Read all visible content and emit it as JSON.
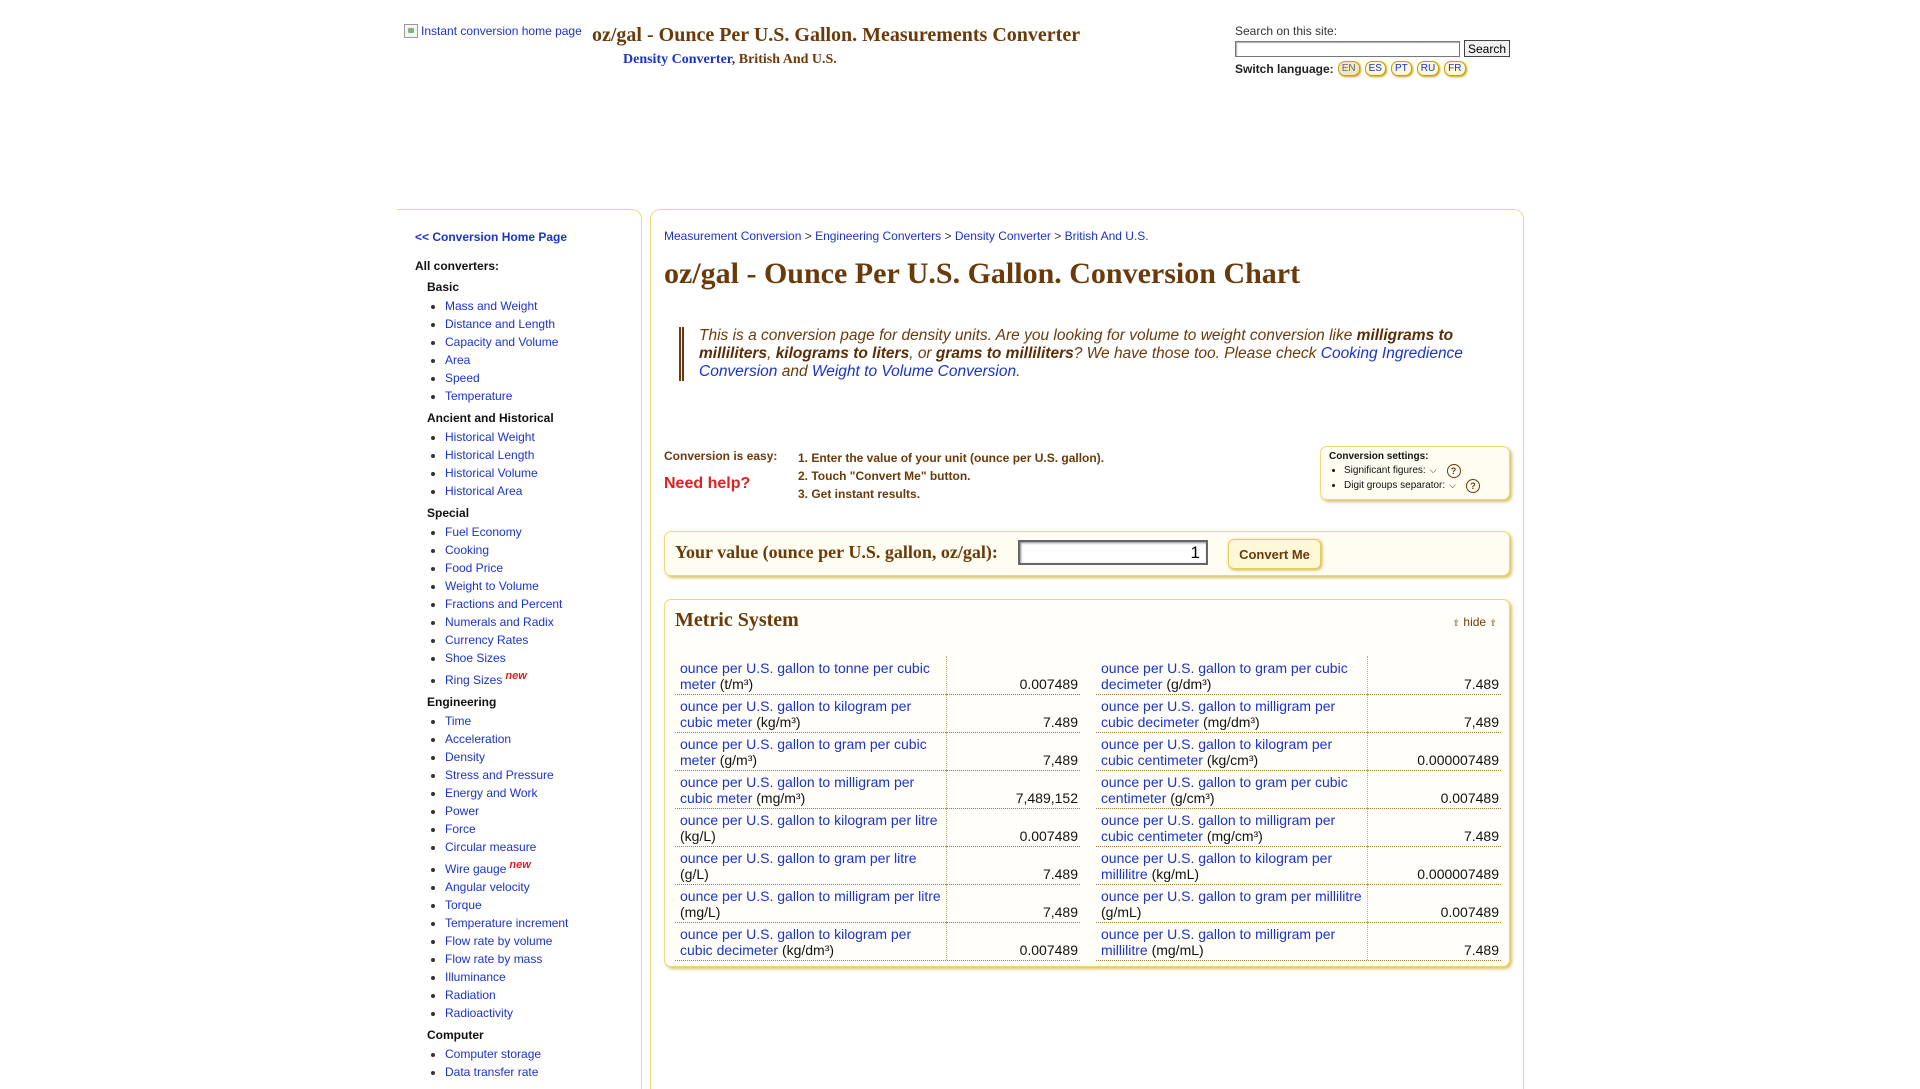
{
  "header": {
    "logo_alt": "Instant conversion home page",
    "title": "oz/gal - Ounce Per U.S. Gallon. Measurements Converter",
    "sub_link": "Density Converter",
    "sub_text": ", British And U.S."
  },
  "search": {
    "label": "Search on this site:",
    "value": "",
    "button": "Search"
  },
  "language": {
    "label": "Switch language:",
    "options": [
      "EN",
      "ES",
      "PT",
      "RU",
      "FR"
    ],
    "active": "EN"
  },
  "sidebar": {
    "home_link": "<< Conversion Home Page",
    "all_label": "All converters:",
    "categories": [
      {
        "title": "Basic",
        "items": [
          "Mass and Weight",
          "Distance and Length",
          "Capacity and Volume",
          "Area",
          "Speed",
          "Temperature"
        ]
      },
      {
        "title": "Ancient and Historical",
        "items": [
          "Historical Weight",
          "Historical Length",
          "Historical Volume",
          "Historical Area"
        ]
      },
      {
        "title": "Special",
        "items": [
          "Fuel Economy",
          "Cooking",
          "Food Price",
          "Weight to Volume",
          "Fractions and Percent",
          "Numerals and Radix",
          "Currency Rates",
          "Shoe Sizes",
          "Ring Sizes"
        ]
      },
      {
        "title": "Engineering",
        "items": [
          "Time",
          "Acceleration",
          "Density",
          "Stress and Pressure",
          "Energy and Work",
          "Power",
          "Force",
          "Circular measure",
          "Wire gauge",
          "Angular velocity",
          "Torque",
          "Temperature increment",
          "Flow rate by volume",
          "Flow rate by mass",
          "Illuminance",
          "Radiation",
          "Radioactivity"
        ]
      },
      {
        "title": "Computer",
        "items": [
          "Computer storage",
          "Data transfer rate"
        ]
      }
    ],
    "new_badge": "new",
    "new_items": [
      "Ring Sizes",
      "Wire gauge"
    ]
  },
  "main": {
    "breadcrumb": [
      "Measurement Conversion",
      "Engineering Converters",
      "Density Converter",
      "British And U.S."
    ],
    "breadcrumb_sep": " > ",
    "page_title": "oz/gal - Ounce Per U.S. Gallon. Conversion Chart",
    "info": {
      "t1": "This is a conversion page for density units. Are you looking for volume to weight conversion like ",
      "b1": "milligrams to milliliters",
      "t2": ", ",
      "b2": "kilograms to liters",
      "t3": ", or ",
      "b3": "grams to milliliters",
      "t4": "? We have those too. Please check ",
      "link1": "Cooking Ingredience Conversion",
      "t5": " and ",
      "link2": "Weight to Volume Conversion",
      "t6": "."
    },
    "easy_label": "Conversion is easy:",
    "help_label": "Need help?",
    "steps": [
      "1. Enter the value of your unit (ounce per U.S. gallon).",
      "2. Touch \"Convert Me\" button.",
      "3. Get instant results."
    ],
    "settings": {
      "title": "Conversion settings:",
      "sig_figs": "Significant figures:",
      "digit_sep": "Digit groups separator:",
      "help": "?"
    },
    "value_label": "Your value (ounce per U.S. gallon, oz/gal):",
    "value": "1",
    "convert_button": "Convert Me"
  },
  "results": {
    "title": "Metric System",
    "hide": "hide",
    "rows": [
      {
        "name": "ounce per U.S. gallon to tonne per cubic meter",
        "abbr": "(t/m³)",
        "value": "0.007489"
      },
      {
        "name": "ounce per U.S. gallon to kilogram per cubic meter",
        "abbr": "(kg/m³)",
        "value": "7.489"
      },
      {
        "name": "ounce per U.S. gallon to gram per cubic meter",
        "abbr": "(g/m³)",
        "value": "7,489"
      },
      {
        "name": "ounce per U.S. gallon to milligram per cubic meter",
        "abbr": "(mg/m³)",
        "value": "7,489,152"
      },
      {
        "name": "ounce per U.S. gallon to kilogram per litre",
        "abbr": "(kg/L)",
        "value": "0.007489"
      },
      {
        "name": "ounce per U.S. gallon to gram per litre",
        "abbr": "(g/L)",
        "value": "7.489"
      },
      {
        "name": "ounce per U.S. gallon to milligram per litre",
        "abbr": "(mg/L)",
        "value": "7,489"
      },
      {
        "name": "ounce per U.S. gallon to kilogram per cubic decimeter",
        "abbr": "(kg/dm³)",
        "value": "0.007489"
      },
      {
        "name": "ounce per U.S. gallon to gram per cubic decimeter",
        "abbr": "(g/dm³)",
        "value": "7.489"
      },
      {
        "name": "ounce per U.S. gallon to milligram per cubic decimeter",
        "abbr": "(mg/dm³)",
        "value": "7,489"
      },
      {
        "name": "ounce per U.S. gallon to kilogram per cubic centimeter",
        "abbr": "(kg/cm³)",
        "value": "0.000007489"
      },
      {
        "name": "ounce per U.S. gallon to gram per cubic centimeter",
        "abbr": "(g/cm³)",
        "value": "0.007489"
      },
      {
        "name": "ounce per U.S. gallon to milligram per cubic centimeter",
        "abbr": "(mg/cm³)",
        "value": "7.489"
      },
      {
        "name": "ounce per U.S. gallon to kilogram per millilitre",
        "abbr": "(kg/mL)",
        "value": "0.000007489"
      },
      {
        "name": "ounce per U.S. gallon to gram per millilitre",
        "abbr": "(g/mL)",
        "value": "0.007489"
      },
      {
        "name": "ounce per U.S. gallon to milligram per millilitre",
        "abbr": "(mg/mL)",
        "value": "7.489"
      }
    ]
  },
  "icons": {
    "logo": "broken-image-icon",
    "hide": "double-chevron-up-icon",
    "select": "chevron-down-icon",
    "help": "question-circle-icon"
  },
  "colors": {
    "brown": "#6b3a0a",
    "link": "#1a33cc",
    "accent_border": "#f0d77a",
    "help_red": "#e02020"
  }
}
